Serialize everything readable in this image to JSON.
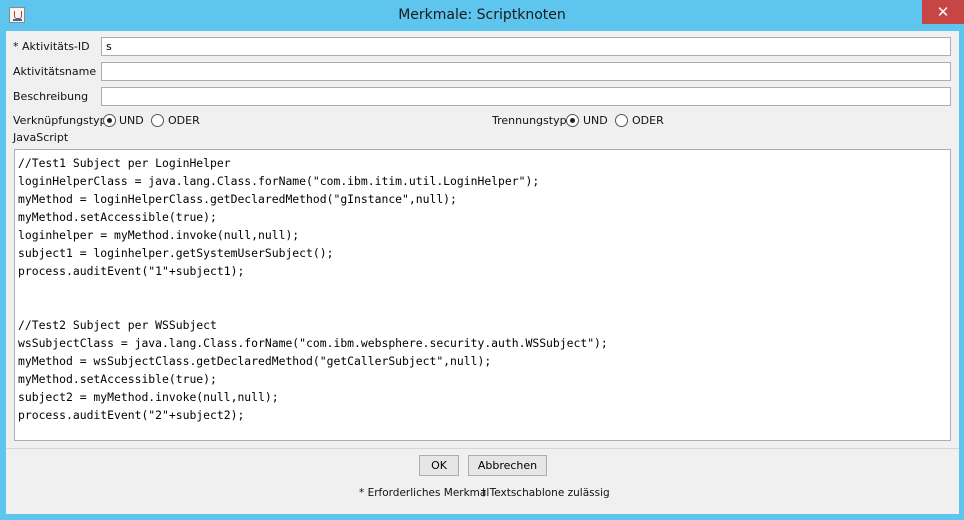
{
  "window": {
    "title": "Merkmale: Scriptknoten",
    "close_glyph": "✕",
    "icon": "java-app-icon"
  },
  "form": {
    "activity_id_label": "* Aktivitäts-ID",
    "activity_id_value": "s",
    "activity_name_label": "Aktivitätsname",
    "activity_name_value": "",
    "description_label": "Beschreibung",
    "description_value": ""
  },
  "join_type": {
    "label": "Verknüpfungstyp",
    "options": [
      {
        "label": "UND",
        "selected": true
      },
      {
        "label": "ODER",
        "selected": false
      }
    ]
  },
  "split_type": {
    "label": "Trennungstyp",
    "options": [
      {
        "label": "UND",
        "selected": true
      },
      {
        "label": "ODER",
        "selected": false
      }
    ]
  },
  "script": {
    "label": "JavaScript",
    "code": "//Test1 Subject per LoginHelper\nloginHelperClass = java.lang.Class.forName(\"com.ibm.itim.util.LoginHelper\");\nmyMethod = loginHelperClass.getDeclaredMethod(\"gInstance\",null);\nmyMethod.setAccessible(true);\nloginhelper = myMethod.invoke(null,null);\nsubject1 = loginhelper.getSystemUserSubject();\nprocess.auditEvent(\"1\"+subject1);\n\n\n//Test2 Subject per WSSubject\nwsSubjectClass = java.lang.Class.forName(\"com.ibm.websphere.security.auth.WSSubject\");\nmyMethod = wsSubjectClass.getDeclaredMethod(\"getCallerSubject\",null);\nmyMethod.setAccessible(true);\nsubject2 = myMethod.invoke(null,null);\nprocess.auditEvent(\"2\"+subject2);"
  },
  "buttons": {
    "ok": "OK",
    "cancel": "Abbrechen"
  },
  "footer": {
    "required_note": "* Erforderliches Merkmal",
    "template_note": "† Textschablone zulässig"
  },
  "colors": {
    "title_bar": "#5ec5ee",
    "close_button": "#c74545",
    "dialog_background": "#f0f0f0"
  }
}
